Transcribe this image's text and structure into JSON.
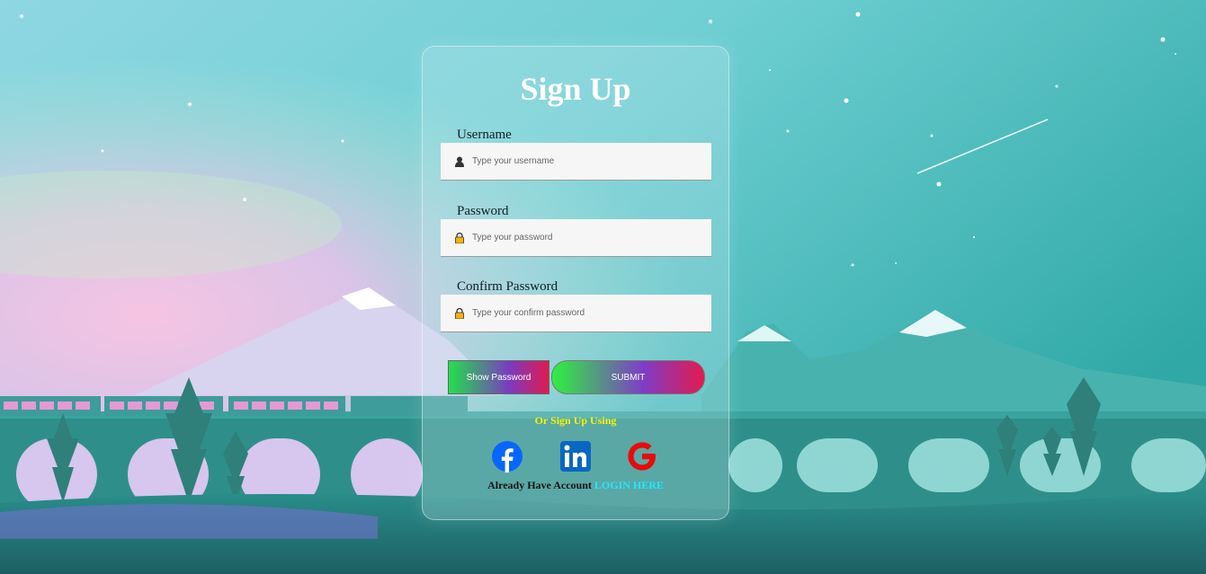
{
  "form": {
    "title": "Sign Up",
    "username": {
      "label": "Username",
      "placeholder": "Type your username",
      "icon": "user-icon"
    },
    "password": {
      "label": "Password",
      "placeholder": "Type your password",
      "icon": "lock-icon"
    },
    "confirm": {
      "label": "Confirm Password",
      "placeholder": "Type your confirm password",
      "icon": "lock-icon"
    },
    "show_password_label": "Show Password",
    "submit_label": "SUBMIT",
    "or_text": "Or Sign Up Using",
    "already_text": "Already Have Account",
    "login_link": "LOGIN HERE"
  },
  "social": [
    {
      "name": "facebook",
      "icon": "facebook-icon",
      "color": "#0866ff"
    },
    {
      "name": "linkedin",
      "icon": "linkedin-icon",
      "color": "#0a66c2"
    },
    {
      "name": "google",
      "icon": "google-icon",
      "color": "#ea0a0a"
    }
  ],
  "colors": {
    "accent_link": "#22e8ff",
    "or_text": "#f4f400",
    "gradient_start": "#2ef040",
    "gradient_mid": "#7e3dc6",
    "gradient_end": "#e31a4e"
  }
}
